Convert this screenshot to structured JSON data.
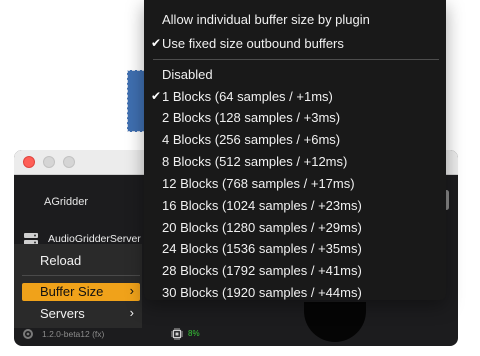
{
  "plugin_window": {
    "title": "AGridder",
    "server_name": "AudioGridderServer",
    "version": "1.2.0-beta12 (fx)",
    "cpu_load": "8%"
  },
  "left_menu": {
    "items": [
      {
        "label": "Reload",
        "chevron": ""
      },
      {
        "label": "Buffer Size",
        "chevron": "›"
      },
      {
        "label": "Servers",
        "chevron": "›"
      }
    ]
  },
  "buffer_menu": {
    "options": [
      {
        "label": "Allow individual buffer size by plugin",
        "checked": ""
      },
      {
        "label": "Use fixed size outbound buffers",
        "checked": "✔"
      }
    ],
    "sizes": [
      {
        "label": "Disabled",
        "checked": ""
      },
      {
        "label": "1 Blocks (64 samples / +1ms)",
        "checked": "✔"
      },
      {
        "label": "2 Blocks (128 samples / +3ms)",
        "checked": ""
      },
      {
        "label": "4 Blocks (256 samples / +6ms)",
        "checked": ""
      },
      {
        "label": "8 Blocks (512 samples / +12ms)",
        "checked": ""
      },
      {
        "label": "12 Blocks (768 samples / +17ms)",
        "checked": ""
      },
      {
        "label": "16 Blocks (1024 samples / +23ms)",
        "checked": ""
      },
      {
        "label": "20 Blocks (1280 samples / +29ms)",
        "checked": ""
      },
      {
        "label": "24 Blocks (1536 samples / +35ms)",
        "checked": ""
      },
      {
        "label": "28 Blocks (1792 samples / +41ms)",
        "checked": ""
      },
      {
        "label": "30 Blocks (1920 samples / +44ms)",
        "checked": ""
      }
    ]
  },
  "colors": {
    "highlight": "#f0a21a",
    "menu_bg": "#191919",
    "cpu_ok": "#37c837",
    "close_button": "#fe5f57"
  }
}
